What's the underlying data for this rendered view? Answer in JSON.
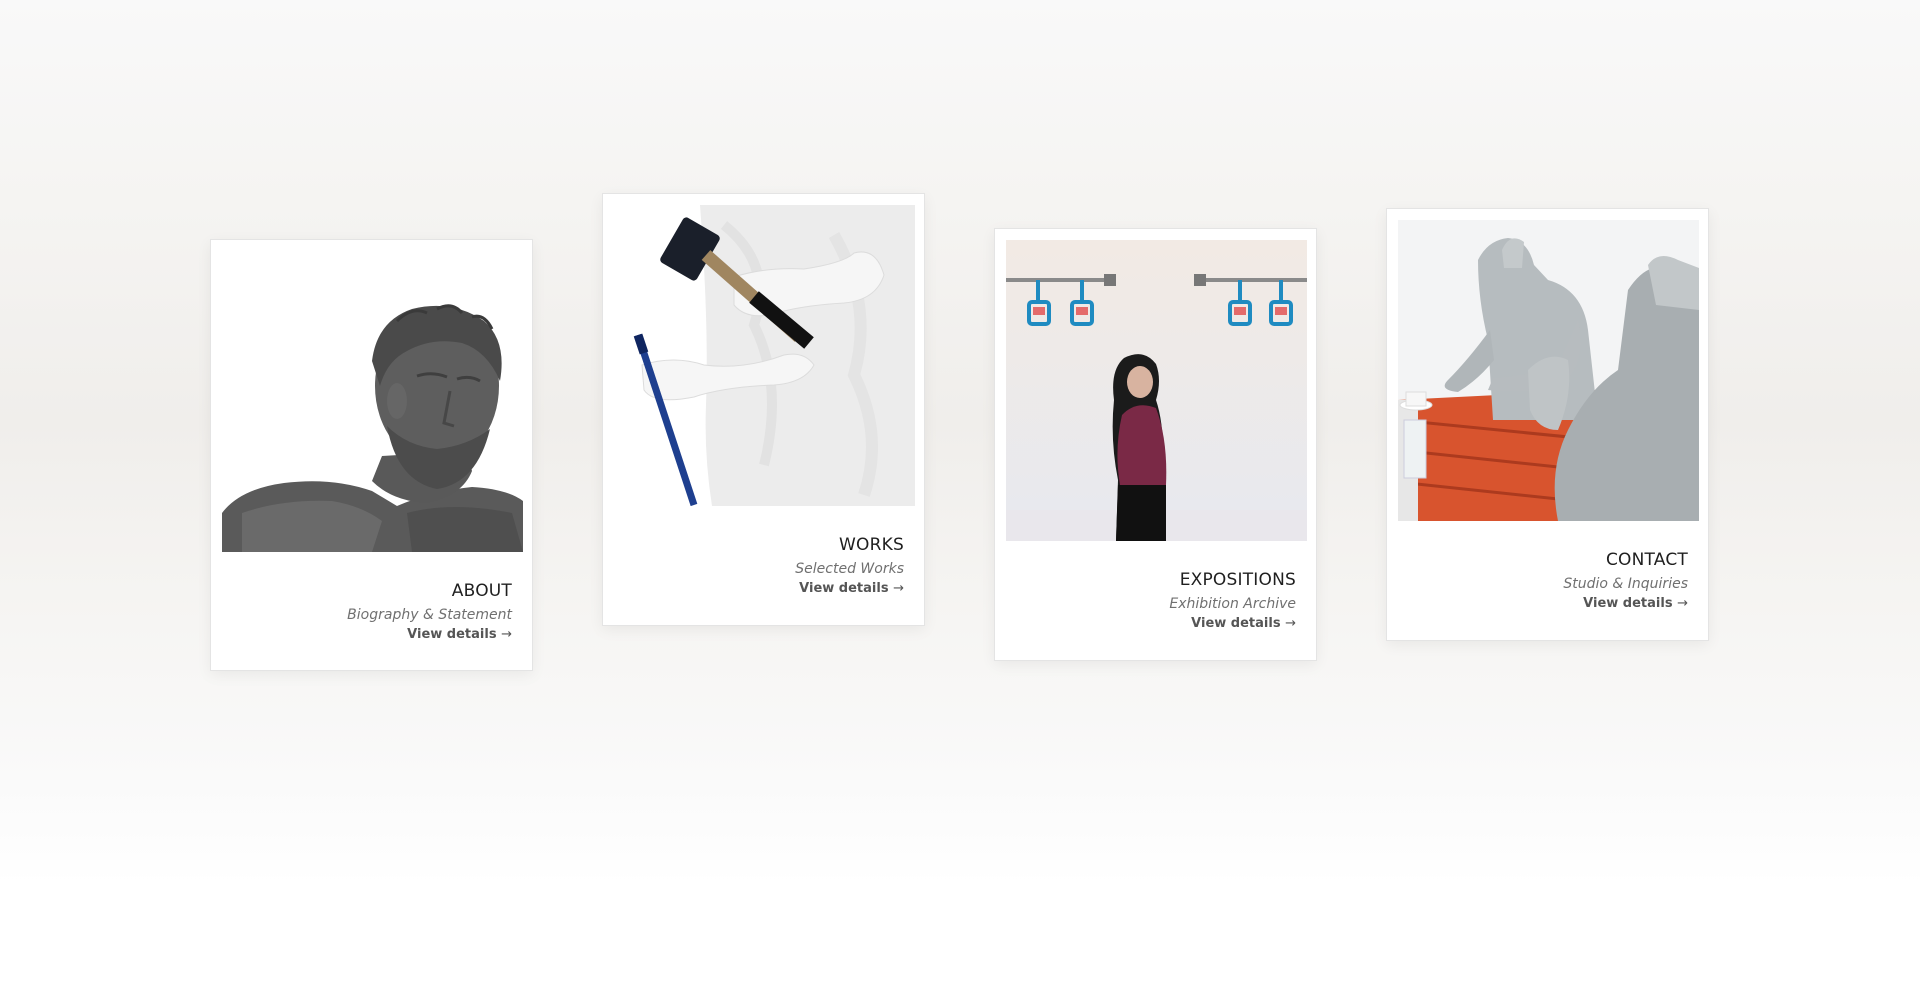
{
  "cards": [
    {
      "title": "ABOUT",
      "subtitle": "Biography & Statement",
      "link": "View details",
      "arrow": "→",
      "image_icon": "bust-sculpture-photo"
    },
    {
      "title": "WORKS",
      "subtitle": "Selected Works",
      "link": "View details",
      "arrow": "→",
      "image_icon": "hands-hammer-chisel-photo"
    },
    {
      "title": "EXPOSITIONS",
      "subtitle": "Exhibition Archive",
      "link": "View details",
      "arrow": "→",
      "image_icon": "gallery-visitor-photo"
    },
    {
      "title": "CONTACT",
      "subtitle": "Studio & Inquiries",
      "link": "View details",
      "arrow": "→",
      "image_icon": "mannequins-table-photo"
    }
  ],
  "colors": {
    "title": "#1f1f1f",
    "subtitle": "#707070",
    "link": "#555555",
    "card_border": "#e4e4e4"
  }
}
